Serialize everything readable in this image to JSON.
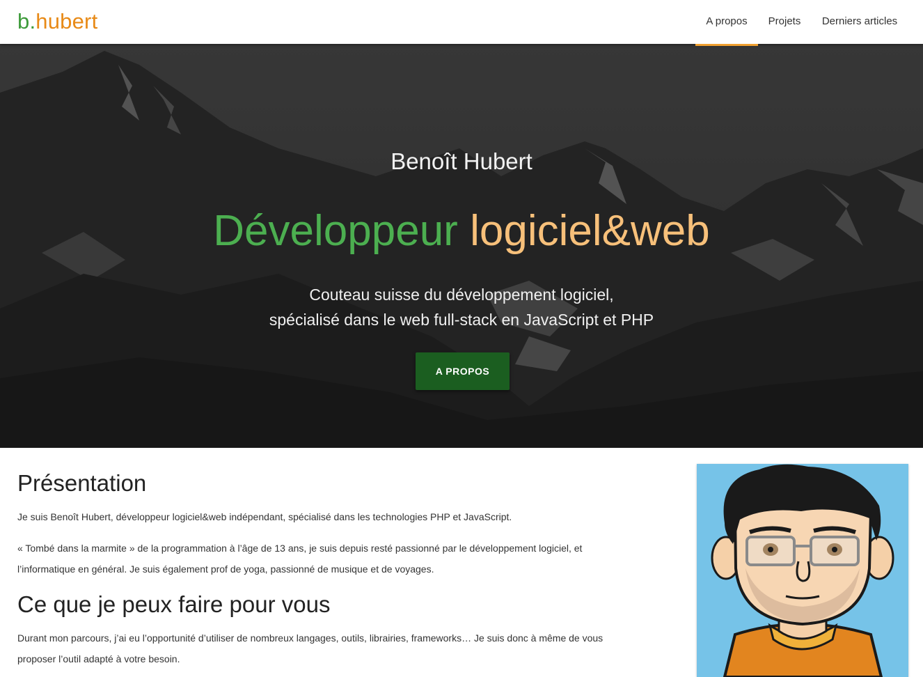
{
  "brand": {
    "b": "b",
    "dot": ".",
    "hubert": "hubert"
  },
  "nav": {
    "items": [
      {
        "label": "A propos",
        "active": true
      },
      {
        "label": "Projets",
        "active": false
      },
      {
        "label": "Derniers articles",
        "active": false
      }
    ]
  },
  "hero": {
    "name": "Benoît Hubert",
    "title_part1": "Développeur",
    "title_part2": "logiciel&web",
    "subtitle_line1": "Couteau suisse du développement logiciel,",
    "subtitle_line2": "spécialisé dans le web full-stack en JavaScript et PHP",
    "button_label": "A PROPOS"
  },
  "content": {
    "presentation_heading": "Présentation",
    "presentation_p1": "Je suis Benoît Hubert, développeur logiciel&web indépendant, spécialisé dans les technologies PHP et JavaScript.",
    "presentation_p2_line1": "« Tombé dans la marmite » de la programmation à l’âge de 13 ans, je suis depuis resté passionné par le développement logiciel, et",
    "presentation_p2_line2": "l’informatique en général. Je suis également prof de yoga, passionné de musique et de voyages.",
    "services_heading": "Ce que je peux faire pour vous",
    "services_p1_line1": "Durant mon parcours, j’ai eu l’opportunité d’utiliser de nombreux langages, outils, librairies, frameworks… Je suis donc à même de vous",
    "services_p1_line2": "proposer l’outil adapté à votre besoin."
  },
  "colors": {
    "brand_green": "#3d9a3a",
    "brand_orange": "#e88a17",
    "nav_active_underline": "#f0a030",
    "hero_green": "#4caf50",
    "hero_peach": "#f7c07a",
    "button_bg": "#1b5e20",
    "avatar_bg": "#76c3e8"
  }
}
